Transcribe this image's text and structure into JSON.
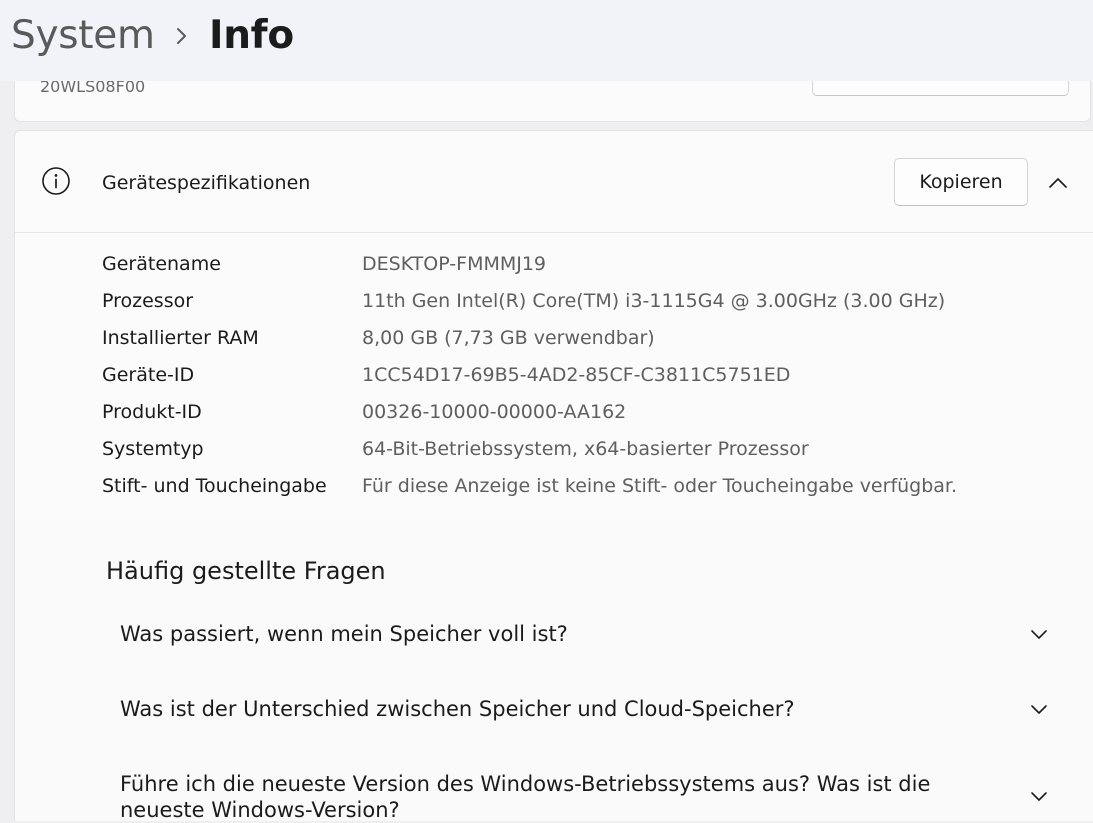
{
  "header": {
    "crumb_parent": "System",
    "crumb_current": "Info"
  },
  "model_card": {
    "model_name": "20WLS08F00"
  },
  "specs": {
    "title": "Gerätespezifikationen",
    "copy_label": "Kopieren",
    "rows": [
      {
        "label": "Gerätename",
        "value": "DESKTOP-FMMMJ19"
      },
      {
        "label": "Prozessor",
        "value": "11th Gen Intel(R) Core(TM) i3-1115G4 @ 3.00GHz   (3.00 GHz)"
      },
      {
        "label": "Installierter RAM",
        "value": "8,00 GB (7,73 GB verwendbar)"
      },
      {
        "label": "Geräte-ID",
        "value": "1CC54D17-69B5-4AD2-85CF-C3811C5751ED"
      },
      {
        "label": "Produkt-ID",
        "value": "00326-10000-00000-AA162"
      },
      {
        "label": "Systemtyp",
        "value": "64-Bit-Betriebssystem, x64-basierter Prozessor"
      },
      {
        "label": "Stift- und Toucheingabe",
        "value": "Für diese Anzeige ist keine Stift- oder Toucheingabe verfügbar."
      }
    ]
  },
  "faq": {
    "title": "Häufig gestellte Fragen",
    "items": [
      {
        "question": "Was passiert, wenn mein Speicher voll ist?"
      },
      {
        "question": "Was ist der Unterschied zwischen Speicher und Cloud-Speicher?"
      },
      {
        "question": "Führe ich die neueste Version des Windows-Betriebssystems aus? Was ist die neueste Windows-Version?"
      }
    ]
  },
  "icons": {
    "breadcrumb_separator": "chevron-right-icon",
    "specs_icon": "info-icon",
    "collapse": "chevron-up-icon",
    "faq_expand": "chevron-down-icon"
  }
}
